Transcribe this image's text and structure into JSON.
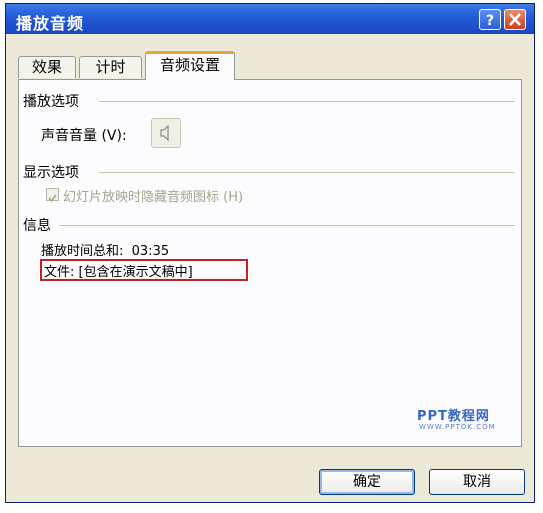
{
  "window": {
    "title": "播放音频",
    "help_icon": "question-mark-icon",
    "close_icon": "close-x-icon"
  },
  "tabs": [
    {
      "label": "效果",
      "active": false
    },
    {
      "label": "计时",
      "active": false
    },
    {
      "label": "音频设置",
      "active": true
    }
  ],
  "playback": {
    "section_title": "播放选项",
    "volume_label": "声音音量 (V):",
    "volume_icon": "speaker-icon"
  },
  "display": {
    "section_title": "显示选项",
    "hide_icon_label": "幻灯片放映时隐藏音频图标 (H)",
    "hide_icon_checked": true,
    "hide_icon_enabled": false
  },
  "info": {
    "section_title": "信息",
    "total_time": "播放时间总和:  03:35",
    "file": "文件: [包含在演示文稿中]"
  },
  "watermark": {
    "main": "PPT教程网",
    "sub": "WWW.PPTOK.COM"
  },
  "buttons": {
    "ok": "确定",
    "cancel": "取消"
  },
  "colors": {
    "titlebar": "#2358d6",
    "highlight_border": "#c32121",
    "active_tab_accent": "#e8a33b"
  }
}
